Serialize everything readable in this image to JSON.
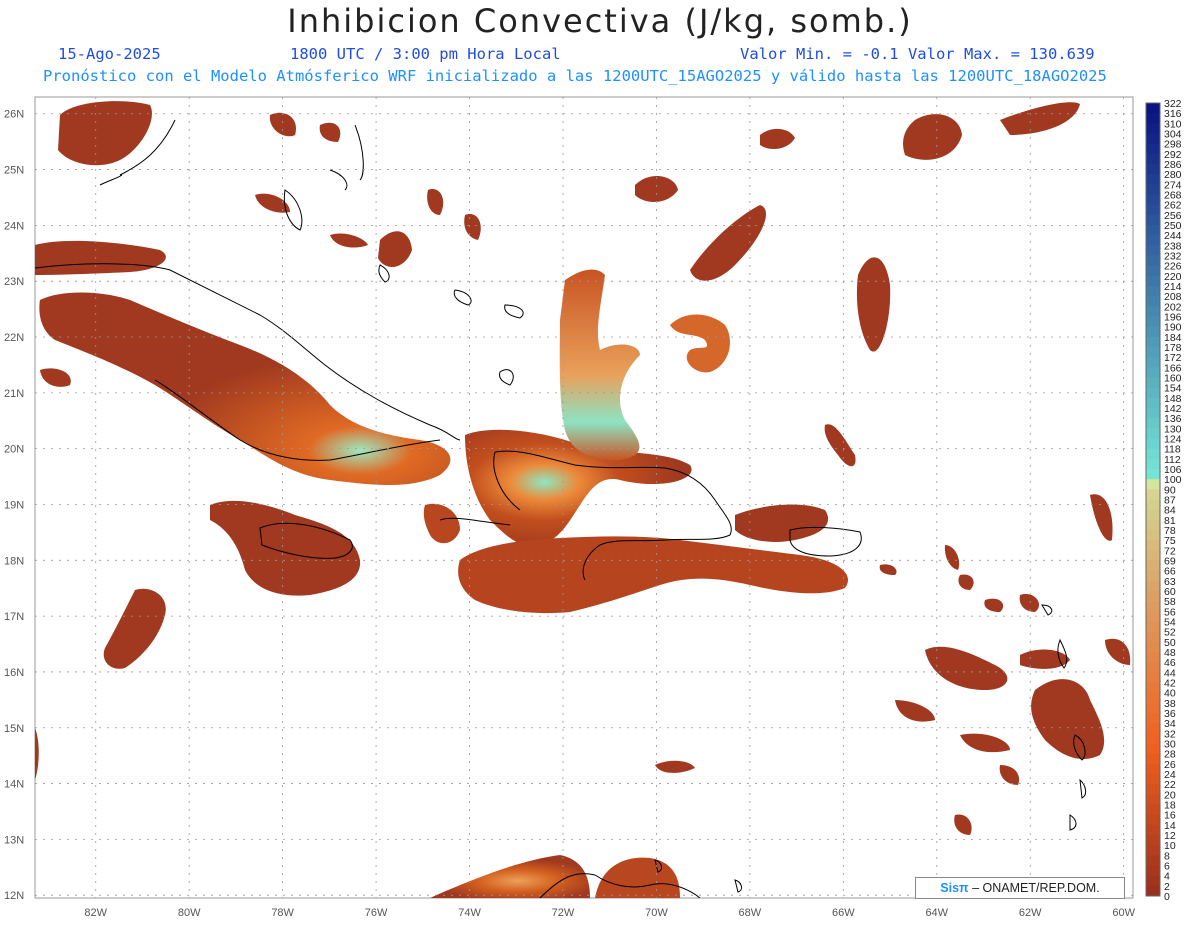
{
  "header": {
    "title": "Inhibicion Convectiva (J/kg, somb.)",
    "date": "15-Ago-2025",
    "time": "1800 UTC / 3:00 pm Hora Local",
    "minmax": "Valor Min. = -0.1  Valor Max. = 130.639",
    "model_line": "Pronóstico con el Modelo Atmósferico WRF inicializado a las 1200UTC_15AGO2025 y válido hasta las  1200UTC_18AGO2025"
  },
  "map": {
    "lon_range": [
      -83.3,
      -59.8
    ],
    "lat_range": [
      11.95,
      26.3
    ],
    "lon_ticks": [
      "82W",
      "80W",
      "78W",
      "76W",
      "74W",
      "72W",
      "70W",
      "68W",
      "66W",
      "64W",
      "62W",
      "60W"
    ],
    "lat_ticks": [
      "26N",
      "25N",
      "24N",
      "23N",
      "22N",
      "21N",
      "20N",
      "19N",
      "18N",
      "17N",
      "16N",
      "15N",
      "14N",
      "13N",
      "12N"
    ],
    "fill_colors": {
      "low": "#a0391f",
      "mid": "#e4621e",
      "high": "#86e2c0",
      "grid": "#999999"
    }
  },
  "colorbar": {
    "labels": [
      "322",
      "316",
      "310",
      "304",
      "298",
      "292",
      "286",
      "280",
      "274",
      "268",
      "262",
      "256",
      "250",
      "244",
      "238",
      "232",
      "226",
      "220",
      "214",
      "208",
      "202",
      "196",
      "190",
      "184",
      "178",
      "172",
      "166",
      "160",
      "154",
      "148",
      "142",
      "136",
      "130",
      "124",
      "118",
      "112",
      "106",
      "100",
      "90",
      "87",
      "84",
      "81",
      "78",
      "75",
      "72",
      "69",
      "66",
      "63",
      "60",
      "58",
      "56",
      "54",
      "52",
      "50",
      "48",
      "46",
      "44",
      "42",
      "40",
      "38",
      "36",
      "34",
      "32",
      "30",
      "28",
      "26",
      "24",
      "22",
      "20",
      "18",
      "16",
      "14",
      "12",
      "10",
      "8",
      "6",
      "4",
      "2",
      "0"
    ]
  },
  "credit": {
    "brand": "Sisπ",
    "text": "– ONAMET/REP.DOM."
  }
}
